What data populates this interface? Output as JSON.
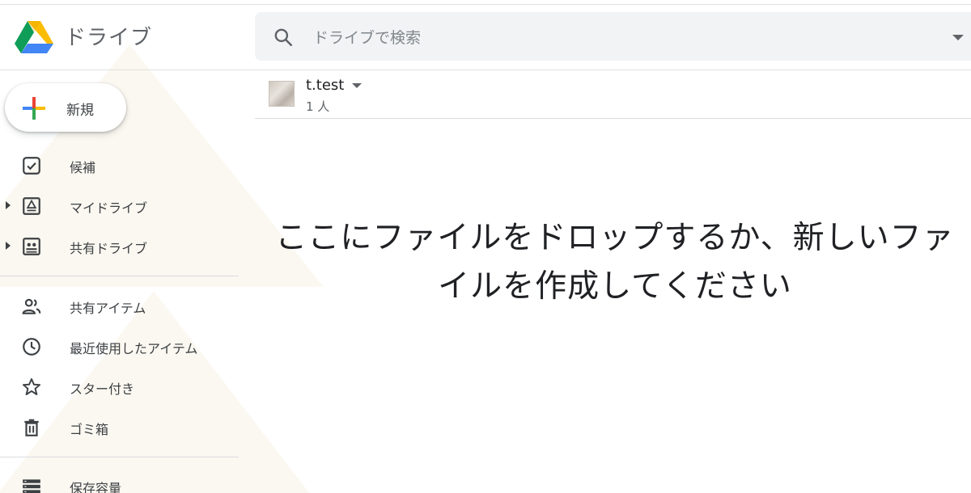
{
  "header": {
    "app_title": "ドライブ",
    "search_placeholder": "ドライブで検索"
  },
  "new_button": {
    "label": "新規"
  },
  "sidebar": {
    "items": [
      {
        "label": "候補",
        "icon": "check-square-icon"
      },
      {
        "label": "マイドライブ",
        "icon": "my-drive-icon"
      },
      {
        "label": "共有ドライブ",
        "icon": "shared-drive-icon"
      },
      {
        "label": "共有アイテム",
        "icon": "people-icon"
      },
      {
        "label": "最近使用したアイテム",
        "icon": "clock-icon"
      },
      {
        "label": "スター付き",
        "icon": "star-icon"
      },
      {
        "label": "ゴミ箱",
        "icon": "trash-icon"
      },
      {
        "label": "保存容量",
        "icon": "storage-icon"
      }
    ]
  },
  "folder_header": {
    "owner": "t.test",
    "members": "1 人"
  },
  "empty_state": {
    "line1": "ここにファイルをドロップするか、新しいファ",
    "line2": "イルを作成してください"
  },
  "colors": {
    "search_bg": "#f1f3f4",
    "text_primary": "#202124",
    "text_secondary": "#5f6368",
    "google_blue": "#4285f4",
    "google_red": "#ea4335",
    "google_yellow": "#fbbc04",
    "google_green": "#34a853"
  }
}
